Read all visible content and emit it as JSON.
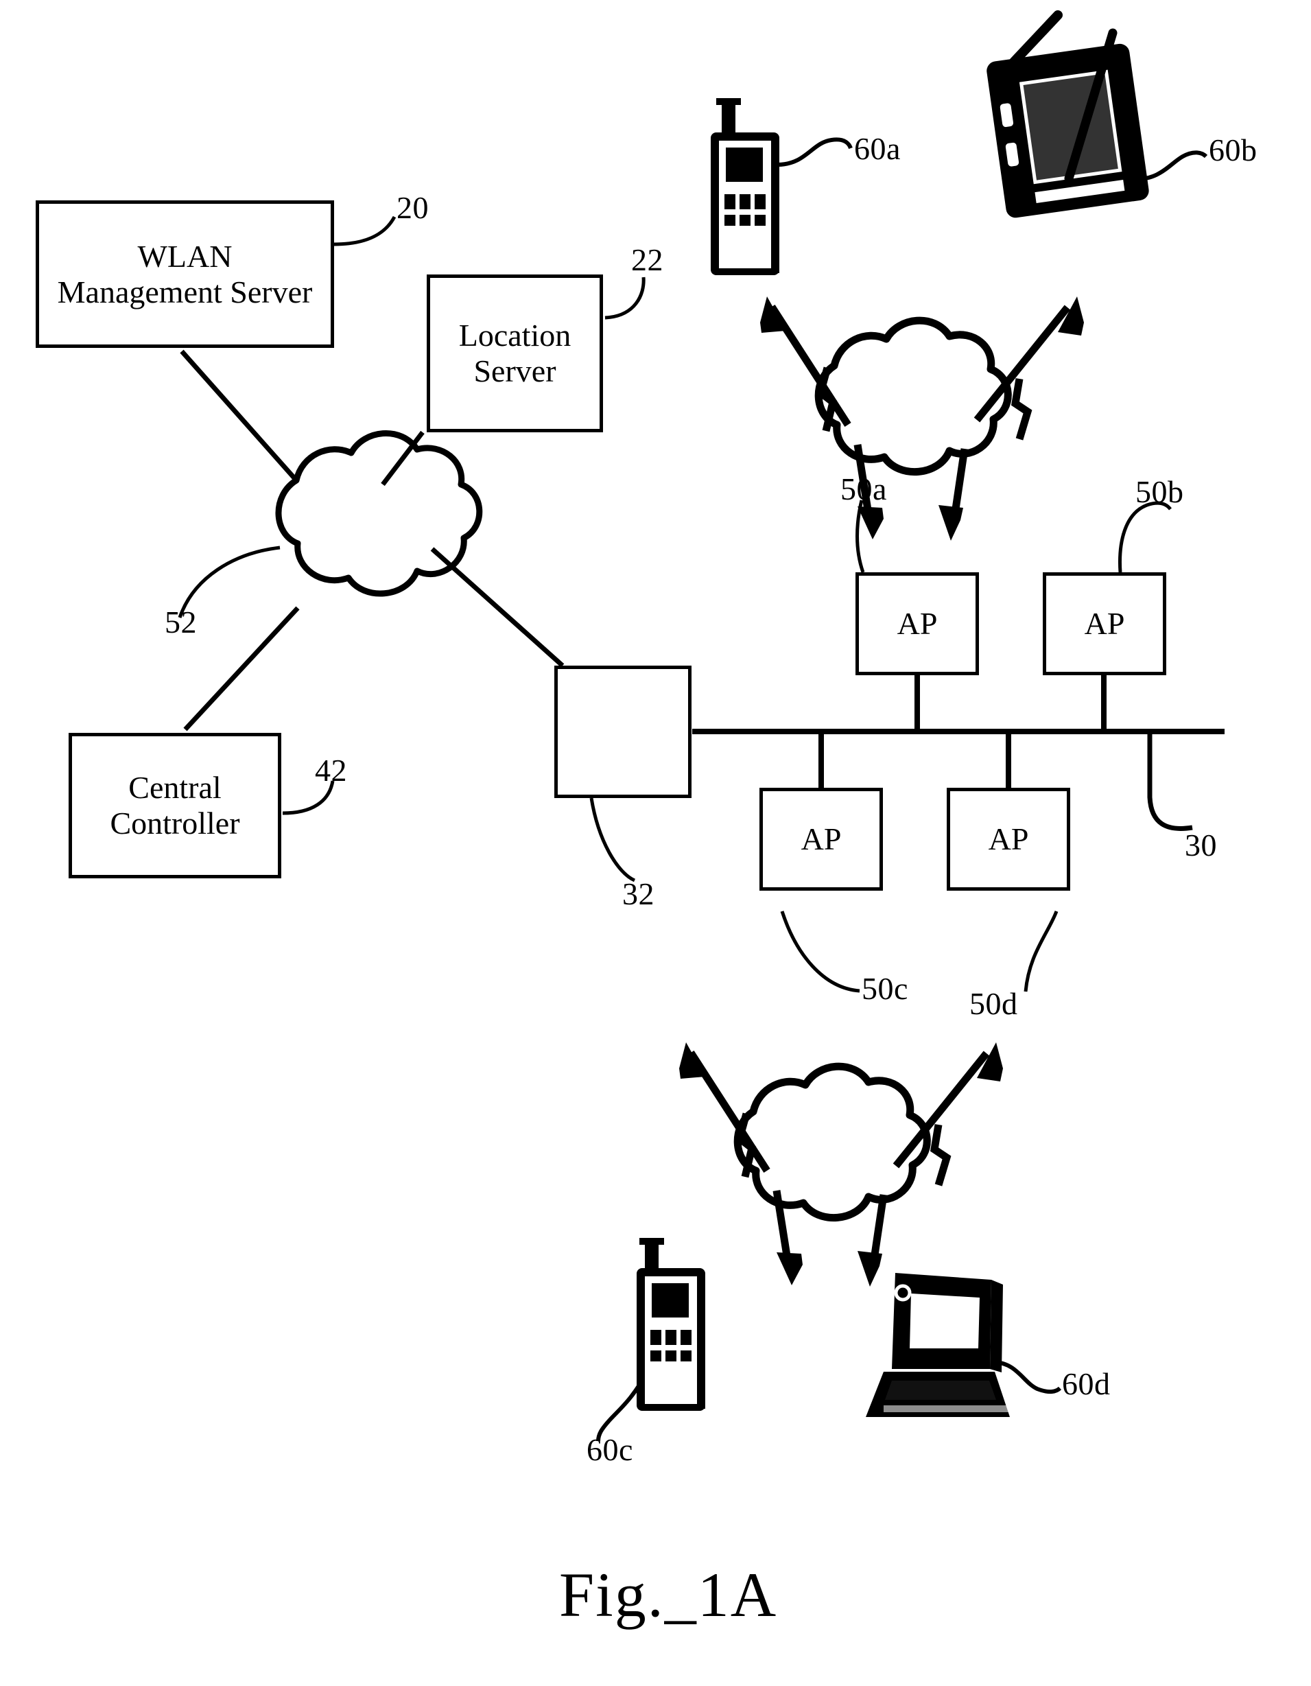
{
  "figure": {
    "caption": "Fig._1A",
    "type": "patent-network-diagram"
  },
  "boxes": {
    "wlan_management_server": {
      "line1": "WLAN",
      "line2": "Management Server",
      "ref": "20"
    },
    "location_server": {
      "line1": "Location",
      "line2": "Server",
      "ref": "22"
    },
    "central_controller": {
      "line1": "Central",
      "line2": "Controller",
      "ref": "42"
    },
    "switch": {
      "label": "",
      "ref": "32"
    },
    "access_points": [
      {
        "label": "AP",
        "ref": "50a"
      },
      {
        "label": "AP",
        "ref": "50b"
      },
      {
        "label": "AP",
        "ref": "50c"
      },
      {
        "label": "AP",
        "ref": "50d"
      }
    ]
  },
  "refs": {
    "network_cloud": "52",
    "lan_backbone": "30"
  },
  "clients": [
    {
      "ref": "60a",
      "icon": "mobile-phone-icon"
    },
    {
      "ref": "60b",
      "icon": "pda-tablet-icon"
    },
    {
      "ref": "60c",
      "icon": "mobile-phone-icon"
    },
    {
      "ref": "60d",
      "icon": "laptop-computer-icon"
    }
  ],
  "wireless_clouds": [
    {
      "name": "upper-wireless-link-cloud"
    },
    {
      "name": "lower-wireless-link-cloud"
    }
  ],
  "colors": {
    "ink": "#000000",
    "paper": "#ffffff"
  }
}
